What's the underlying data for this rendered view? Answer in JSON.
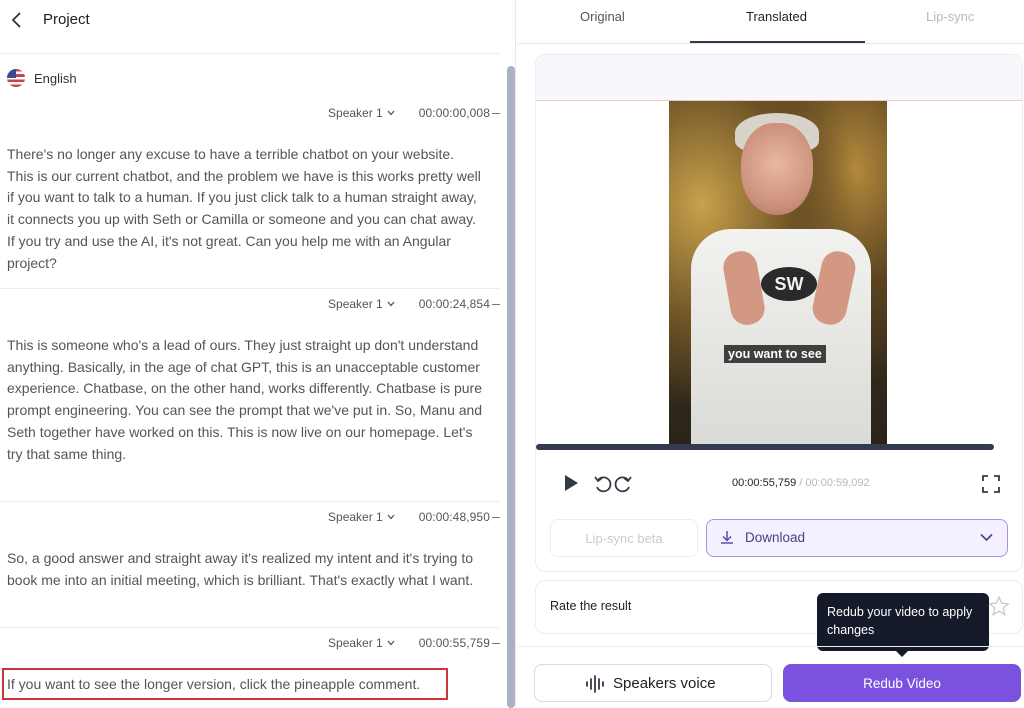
{
  "header": {
    "title": "Project"
  },
  "language": {
    "label": "English",
    "flag_icon": "us-flag-icon"
  },
  "segments": [
    {
      "speaker": "Speaker 1",
      "timecode": "00:00:00,008",
      "text": "There's no longer any excuse to have a terrible chatbot on your website. This is our current chatbot, and the problem we have is this works pretty well if you want to talk to a human. If you just click talk to a human straight away, it connects you up with Seth or Camilla or someone and you can chat away. If you try and use the AI, it's not great. Can you help me with an Angular project?"
    },
    {
      "speaker": "Speaker 1",
      "timecode": "00:00:24,854",
      "text": "This is someone who's a lead of ours. They just straight up don't understand anything. Basically, in the age of chat GPT, this is an unacceptable customer experience. Chatbase, on the other hand, works differently. Chatbase is pure prompt engineering. You can see the prompt that we've put in. So, Manu and Seth together have worked on this. This is now live on our homepage. Let's try that same thing."
    },
    {
      "speaker": "Speaker 1",
      "timecode": "00:00:48,950",
      "text": "So, a good answer and straight away it's realized my intent and it's trying to book me into an initial meeting, which is brilliant. That's exactly what I want."
    },
    {
      "speaker": "Speaker 1",
      "timecode": "00:00:55,759",
      "text": "If you want to see the longer version, click the pineapple comment."
    }
  ],
  "tabs": {
    "original": "Original",
    "translated": "Translated",
    "lipsync": "Lip-sync"
  },
  "player": {
    "caption": "you want to see",
    "shirt_logo": "SW",
    "current_time": "00:00:55,759",
    "total_time": "/ 00:00:59,092"
  },
  "actions": {
    "lipsync_label": "Lip-sync beta",
    "download_label": "Download",
    "rate_label": "Rate the result",
    "speakers_voice_label": "Speakers voice",
    "redub_label": "Redub Video"
  },
  "tooltip": {
    "text": "Redub your video to apply changes"
  },
  "colors": {
    "accent": "#7b52de",
    "highlight_border": "#c8373d",
    "tooltip_bg": "#151a2a"
  }
}
